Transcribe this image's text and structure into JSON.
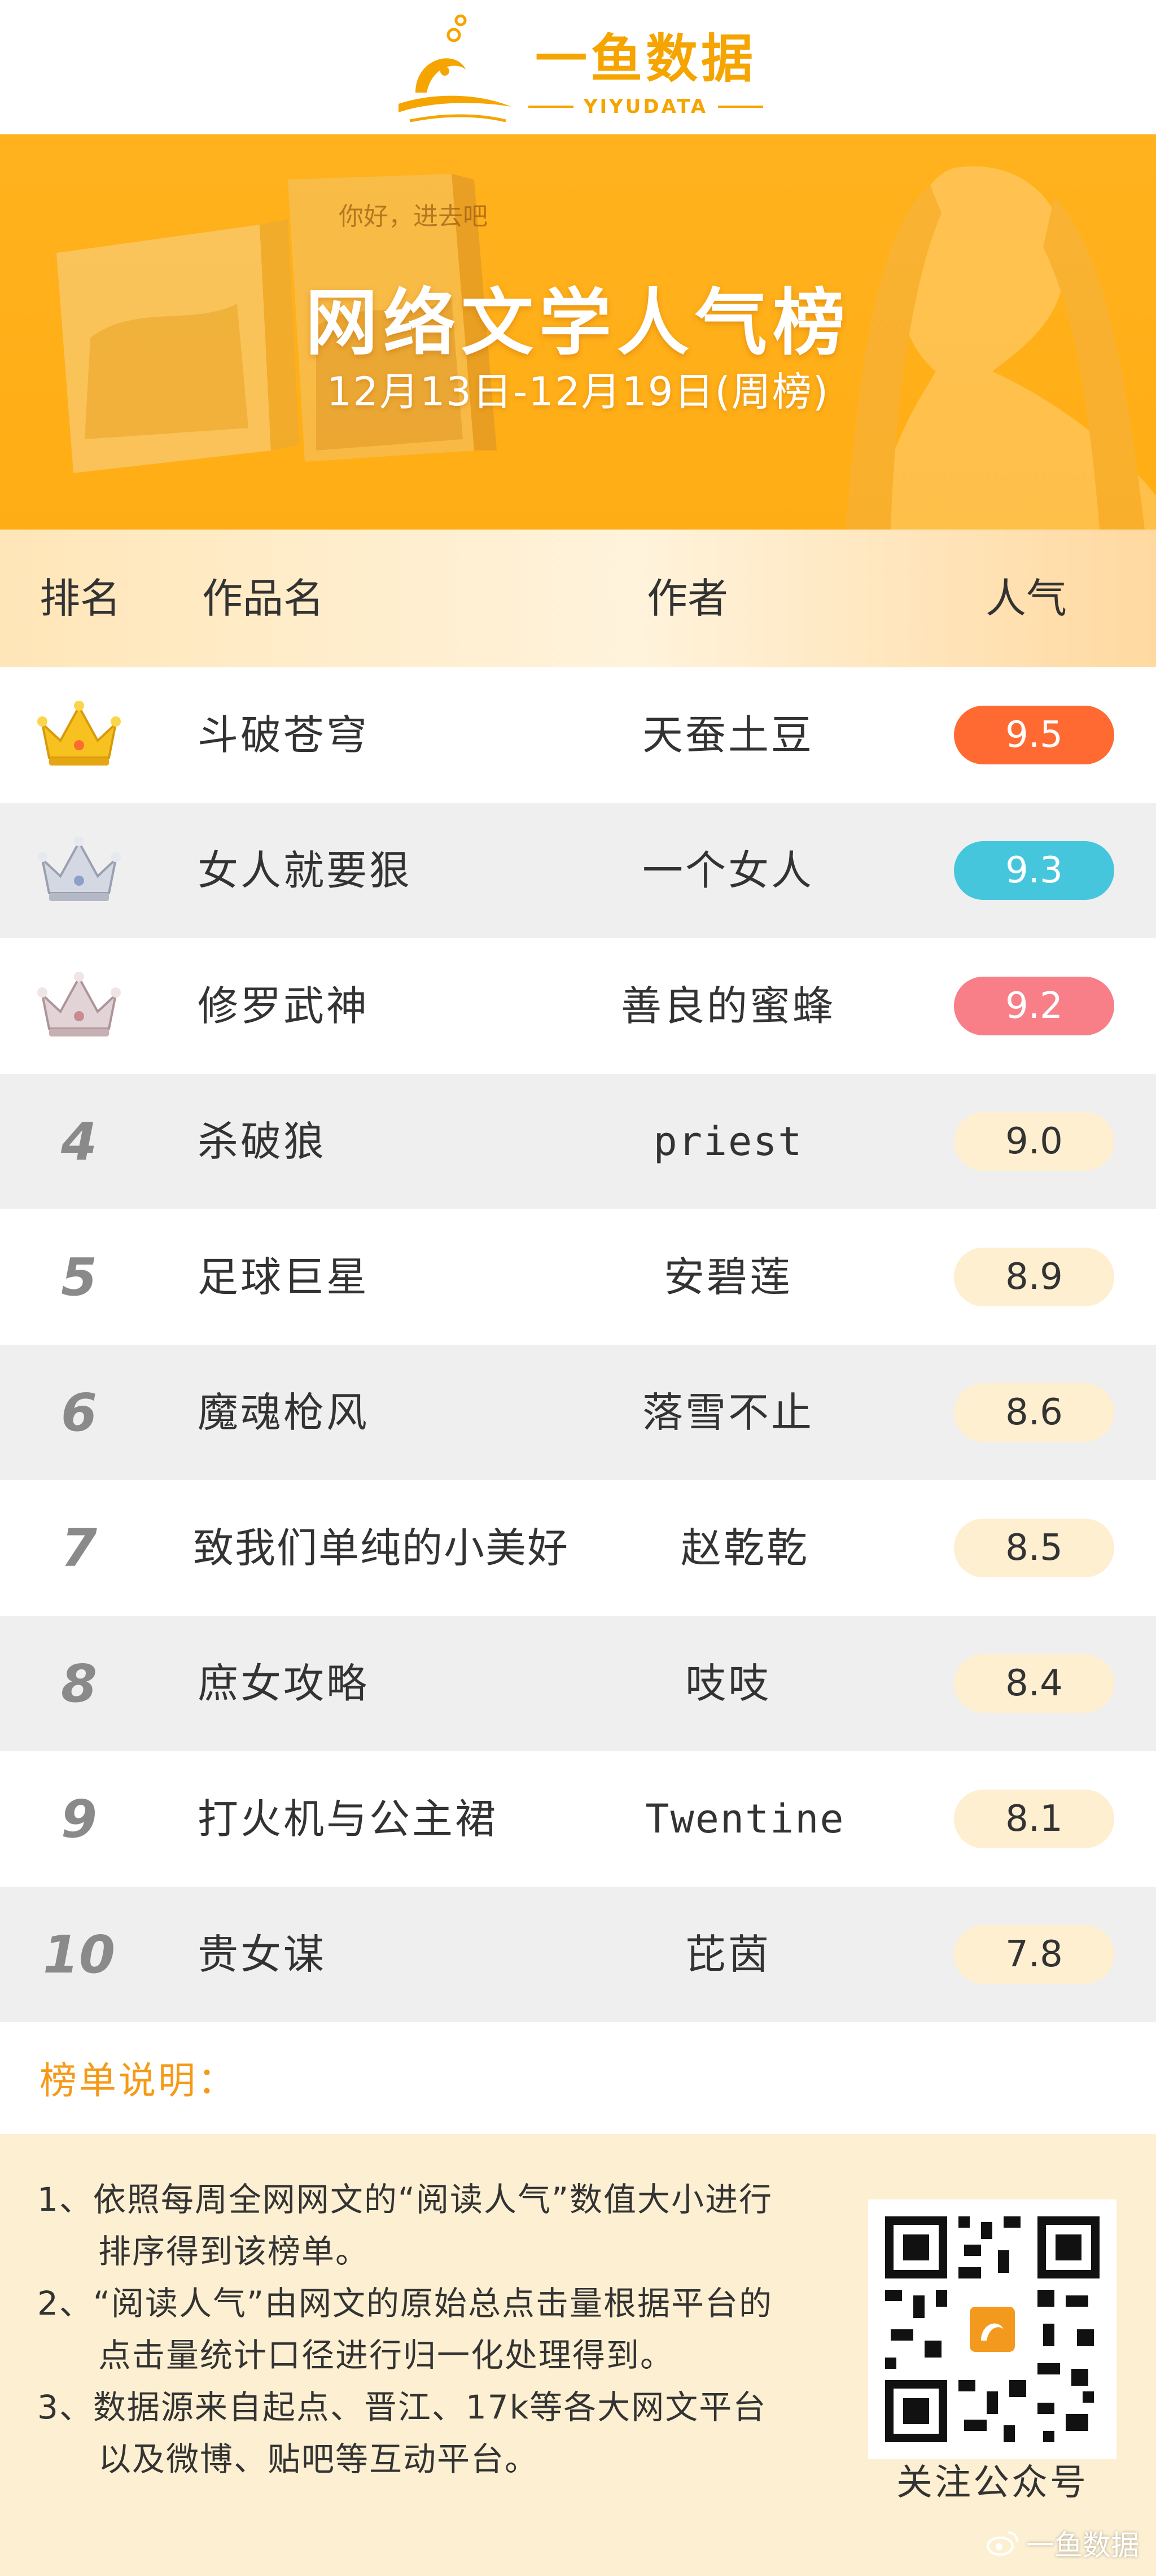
{
  "header": {
    "logo_cn": "一鱼数据",
    "logo_en": "YIYUDATA"
  },
  "banner": {
    "book_title": "你好，进去吧",
    "title": "网络文学人气榜",
    "subtitle": "12月13日-12月19日(周榜)"
  },
  "table": {
    "columns": [
      "排名",
      "作品名",
      "作者",
      "人气"
    ],
    "rows": [
      {
        "rank": "1",
        "title": "斗破苍穹",
        "author": "天蚕土豆",
        "score": "9.5"
      },
      {
        "rank": "2",
        "title": "女人就要狠",
        "author": "一个女人",
        "score": "9.3"
      },
      {
        "rank": "3",
        "title": "修罗武神",
        "author": "善良的蜜蜂",
        "score": "9.2"
      },
      {
        "rank": "4",
        "title": "杀破狼",
        "author": "priest",
        "score": "9.0"
      },
      {
        "rank": "5",
        "title": "足球巨星",
        "author": "安碧莲",
        "score": "8.9"
      },
      {
        "rank": "6",
        "title": "魔魂枪风",
        "author": "落雪不止",
        "score": "8.6"
      },
      {
        "rank": "7",
        "title": "致我们单纯的小美好",
        "author": "赵乾乾",
        "score": "8.5"
      },
      {
        "rank": "8",
        "title": "庶女攻略",
        "author": "吱吱",
        "score": "8.4"
      },
      {
        "rank": "9",
        "title": "打火机与公主裙",
        "author": "Twentine",
        "score": "8.1"
      },
      {
        "rank": "10",
        "title": "贵女谋",
        "author": "芘茵",
        "score": "7.8"
      }
    ]
  },
  "colors": {
    "accent": "#ffaf17",
    "rank1": "#ff6a32",
    "rank2": "#45c6dd",
    "rank3": "#f87e88",
    "score_bg": "#fdefd0",
    "crown_gold": "#f7c21f",
    "crown_silver": "#c9cdd8"
  },
  "notes": {
    "title": "榜单说明：",
    "items": [
      {
        "line1": "1、依照每周全网网文的“阅读人气”数值大小进行",
        "line2": "排序得到该榜单。"
      },
      {
        "line1": "2、“阅读人气”由网文的原始总点击量根据平台的",
        "line2": "点击量统计口径进行归一化处理得到。"
      },
      {
        "line1": "3、数据源来自起点、晋江、17k等各大网文平台",
        "line2": "以及微博、贴吧等互动平台。"
      }
    ],
    "qr_caption": "关注公众号",
    "watermark": "一鱼数据"
  }
}
